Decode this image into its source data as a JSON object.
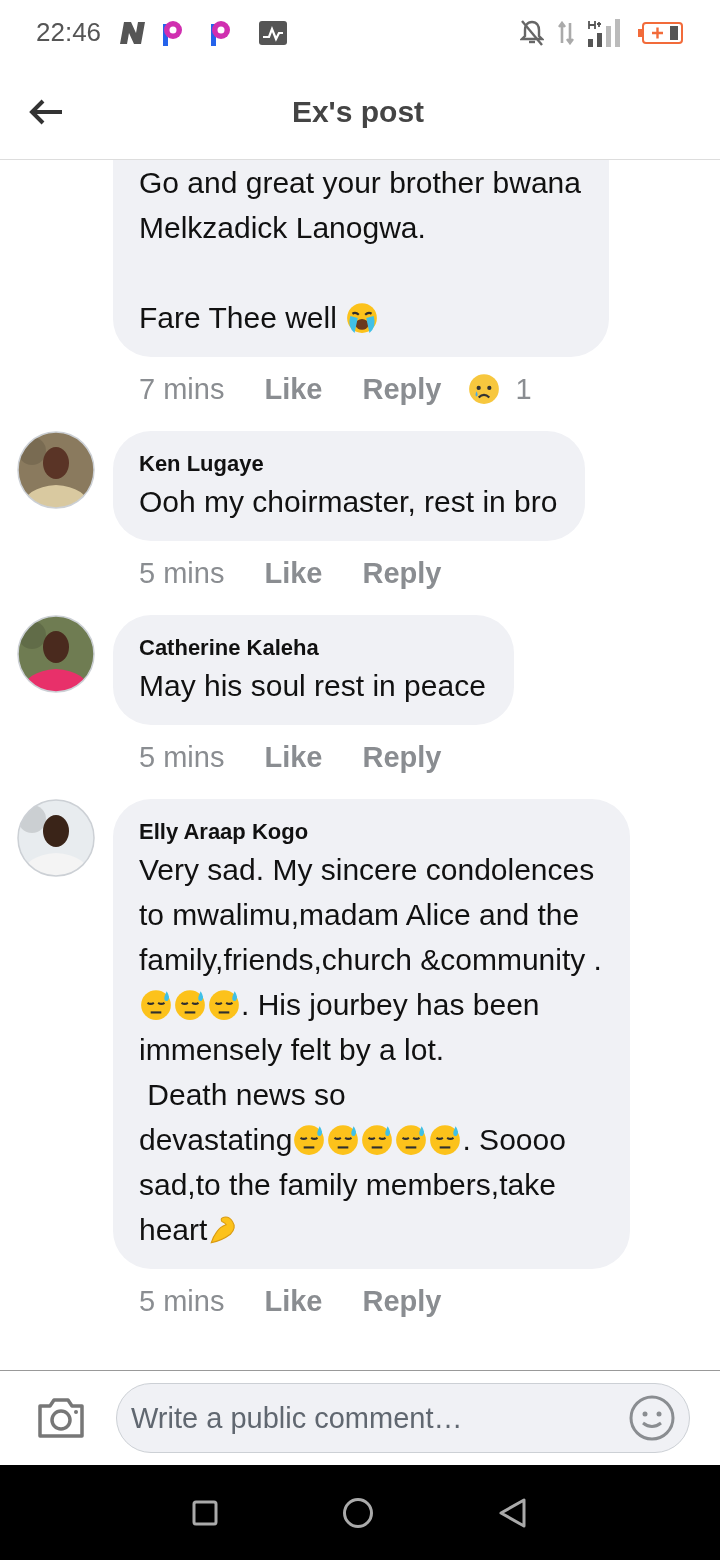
{
  "status_bar": {
    "time": "22:46"
  },
  "header": {
    "title": "Ex's post"
  },
  "comments": [
    {
      "paragraphs": [
        [
          [
            {
              "kind": "text",
              "text": "Go and great your brother bwana"
            }
          ],
          [
            {
              "kind": "text",
              "text": "Melkzadick Lanogwa."
            }
          ]
        ],
        [
          [
            {
              "kind": "text",
              "text": "Fare Thee well "
            },
            {
              "kind": "crying"
            }
          ]
        ]
      ],
      "time": "7 mins",
      "like": "Like",
      "reply": "Reply",
      "reaction_count": "1"
    },
    {
      "author": "Ken Lugaye",
      "paragraphs": [
        [
          [
            {
              "kind": "text",
              "text": "Ooh my choirmaster, rest in bro"
            }
          ]
        ]
      ],
      "time": "5 mins",
      "like": "Like",
      "reply": "Reply"
    },
    {
      "author": "Catherine Kaleha",
      "paragraphs": [
        [
          [
            {
              "kind": "text",
              "text": "May his soul rest in peace"
            }
          ]
        ]
      ],
      "time": "5 mins",
      "like": "Like",
      "reply": "Reply"
    },
    {
      "author": "Elly Araap Kogo",
      "paragraphs": [
        [
          [
            {
              "kind": "text",
              "text": "Very sad. My sincere condolences"
            }
          ],
          [
            {
              "kind": "text",
              "text": "to mwalimu,madam Alice and the"
            }
          ],
          [
            {
              "kind": "text",
              "text": "family,friends,church &community ."
            }
          ],
          [
            {
              "kind": "sweat"
            },
            {
              "kind": "sweat"
            },
            {
              "kind": "sweat"
            },
            {
              "kind": "text",
              "text": ". His jourbey has been"
            }
          ],
          [
            {
              "kind": "text",
              "text": "immensely felt by a lot."
            }
          ],
          [
            {
              "kind": "text",
              "text": " Death news so"
            }
          ],
          [
            {
              "kind": "text",
              "text": "devastating"
            },
            {
              "kind": "sweat"
            },
            {
              "kind": "sweat"
            },
            {
              "kind": "sweat"
            },
            {
              "kind": "sweat"
            },
            {
              "kind": "sweat"
            },
            {
              "kind": "text",
              "text": ". Soooo"
            }
          ],
          [
            {
              "kind": "text",
              "text": "sad,to the family members,take"
            }
          ],
          [
            {
              "kind": "text",
              "text": "heart"
            },
            {
              "kind": "muscle"
            }
          ]
        ]
      ],
      "time": "5 mins",
      "like": "Like",
      "reply": "Reply"
    }
  ],
  "composer": {
    "placeholder": "Write a public comment…"
  }
}
